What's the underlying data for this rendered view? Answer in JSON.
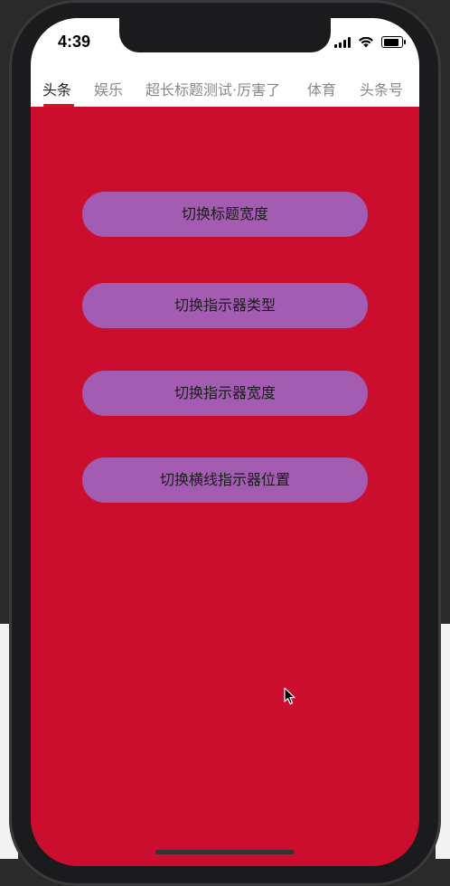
{
  "status_bar": {
    "time": "4:39"
  },
  "tabs": [
    {
      "label": "头条",
      "selected": true
    },
    {
      "label": "娱乐",
      "selected": false
    },
    {
      "label": "超长标题测试·厉害了",
      "selected": false
    },
    {
      "label": "体育",
      "selected": false
    },
    {
      "label": "头条号",
      "selected": false
    }
  ],
  "buttons": {
    "toggle_title_width": "切换标题宽度",
    "toggle_indicator_type": "切换指示器类型",
    "toggle_indicator_width": "切换指示器宽度",
    "toggle_line_indicator_position": "切换横线指示器位置"
  },
  "colors": {
    "page_background": "#cc0e2e",
    "button_background": "#a35cb2",
    "indicator": "#e0111b",
    "tab_selected": "#222222",
    "tab_unselected": "#888888"
  }
}
